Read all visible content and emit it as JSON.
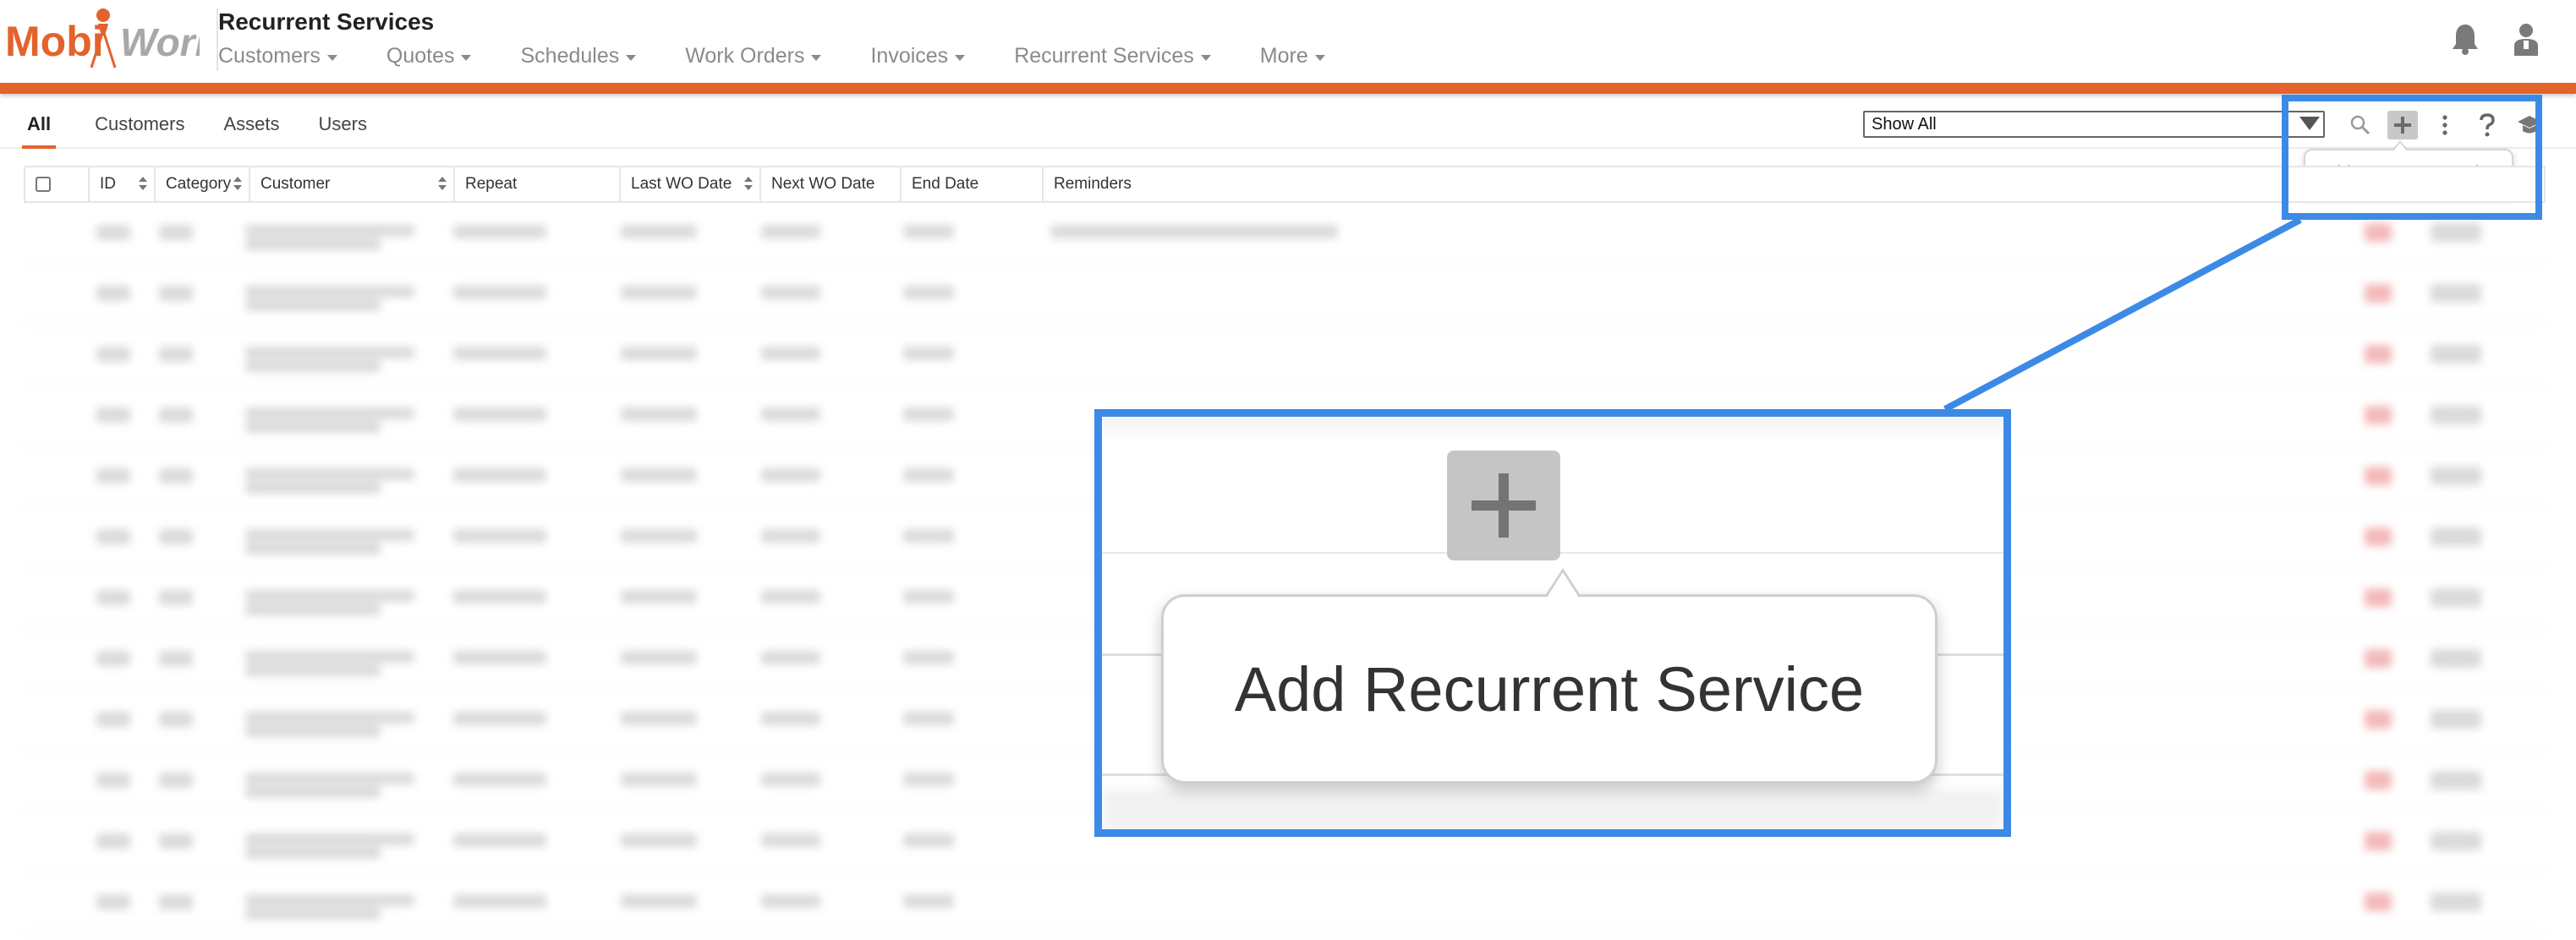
{
  "app": {
    "logo_text_left": "Mobi",
    "logo_text_right": "Work",
    "page_title": "Recurrent Services",
    "brand_color": "#e4622c",
    "highlight_color": "#3d8ae6"
  },
  "nav": {
    "items": [
      {
        "label": "Customers"
      },
      {
        "label": "Quotes"
      },
      {
        "label": "Schedules"
      },
      {
        "label": "Work Orders"
      },
      {
        "label": "Invoices"
      },
      {
        "label": "Recurrent Services"
      },
      {
        "label": "More"
      }
    ],
    "icons": [
      "bell-icon",
      "user-icon"
    ]
  },
  "toolbar": {
    "tabs": [
      {
        "label": "All",
        "active": true
      },
      {
        "label": "Customers",
        "active": false
      },
      {
        "label": "Assets",
        "active": false
      },
      {
        "label": "Users",
        "active": false
      }
    ],
    "filter_value": "Show All",
    "icons": [
      "search-icon",
      "add-icon",
      "more-vertical-icon",
      "help-icon",
      "tutorial-icon"
    ],
    "tooltip": "Add Recurrent Service"
  },
  "table": {
    "columns": [
      {
        "label": "ID",
        "sortable": true
      },
      {
        "label": "Category",
        "sortable": true
      },
      {
        "label": "Customer",
        "sortable": true
      },
      {
        "label": "Repeat",
        "sortable": false
      },
      {
        "label": "Last WO Date",
        "sortable": true
      },
      {
        "label": "Next WO Date",
        "sortable": false
      },
      {
        "label": "End Date",
        "sortable": false
      },
      {
        "label": "Reminders",
        "sortable": false
      }
    ],
    "row_count": 12,
    "rows_blurred": true
  },
  "callout": {
    "zoomed_tooltip": "Add Recurrent Service"
  }
}
